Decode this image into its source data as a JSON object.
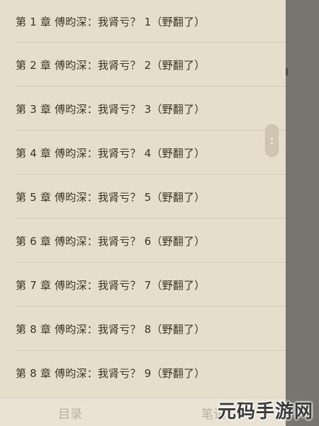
{
  "chapters": [
    {
      "label": "第 1 章 傅昀深：我肾亏？ 1（野翻了）"
    },
    {
      "label": "第 2 章 傅昀深：我肾亏？ 2（野翻了）"
    },
    {
      "label": "第 3 章 傅昀深：我肾亏？ 3（野翻了）"
    },
    {
      "label": "第 4 章 傅昀深：我肾亏？ 4（野翻了）"
    },
    {
      "label": "第 5 章 傅昀深：我肾亏？ 5（野翻了）"
    },
    {
      "label": "第 6 章 傅昀深：我肾亏？ 6（野翻了）"
    },
    {
      "label": "第 7 章 傅昀深：我肾亏？ 7（野翻了）"
    },
    {
      "label": "第 8 章 傅昀深：我肾亏？ 8（野翻了）"
    },
    {
      "label": "第 8 章 傅昀深：我肾亏？ 9（野翻了）"
    }
  ],
  "bottom_tabs": {
    "toc_label": "目录",
    "notes_label": "笔记"
  },
  "watermark": {
    "text": "元码手游网"
  },
  "colors": {
    "panel_bg": "#e6ddcb",
    "text": "#3c3426",
    "backdrop": "#77756c",
    "tab_text": "#b9b0a0"
  }
}
